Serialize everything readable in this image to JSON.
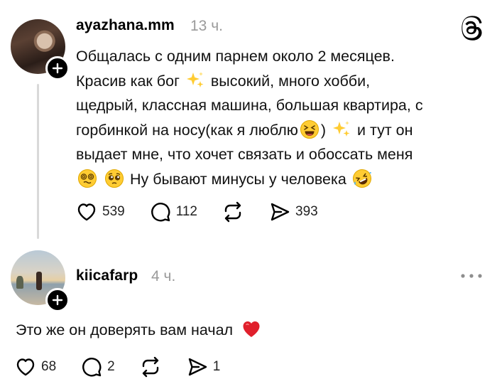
{
  "post": {
    "username": "ayazhana.mm",
    "time": "13 ч.",
    "lines": [
      [
        "Общалась с одним парнем около 2 месяцев."
      ],
      [
        "Красив как бог ",
        " высокий, много хобби,"
      ],
      [
        "щедрый, классная машина, большая квартира, с"
      ],
      [
        "горбинкой на носу(как я люблю",
        ") ",
        " и тут он"
      ],
      [
        "выдает мне, что хочет связать и обоссать меня"
      ],
      [
        " ",
        " Ну бывают минусы у человека "
      ]
    ],
    "likes": "539",
    "comments": "112",
    "shares": "393"
  },
  "reply": {
    "username": "kiicafarp",
    "time": "4 ч.",
    "text": "Это же он доверять вам начал",
    "likes": "68",
    "comments": "2",
    "shares": "1"
  },
  "icons": {
    "app_logo": "threads-logo-icon",
    "follow": "plus-icon",
    "like": "heart-icon",
    "comment": "comment-bubble-icon",
    "repost": "repost-icon",
    "share": "send-icon",
    "more": "more-dots-icon"
  },
  "colors": {
    "time": "#9a9a9a",
    "thread_line": "#d9d9d9",
    "heart_emoji": "#e0202c"
  }
}
